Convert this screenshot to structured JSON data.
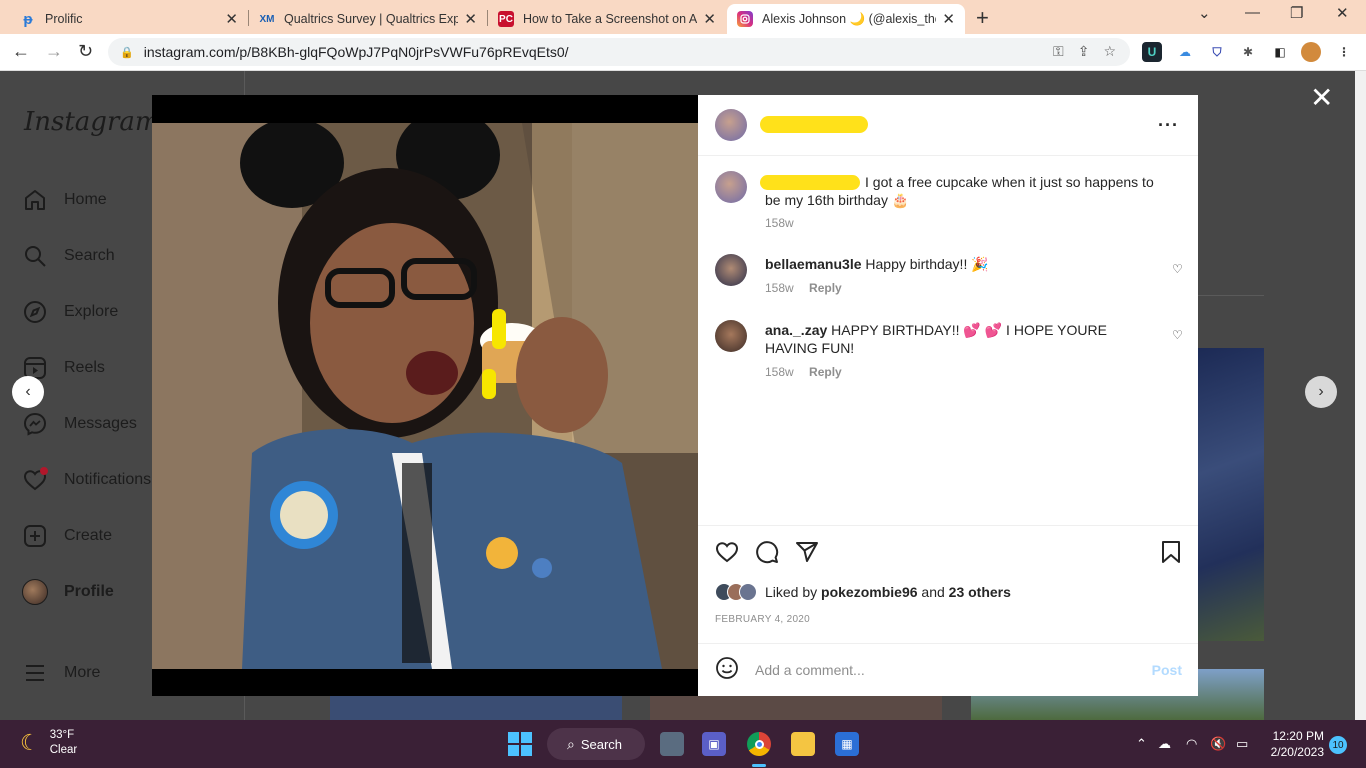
{
  "browser": {
    "tabs": [
      {
        "title": "Prolific",
        "favicon": "prolific-icon",
        "active": false
      },
      {
        "title": "Qualtrics Survey | Qualtrics Exper",
        "favicon": "XM",
        "active": false
      },
      {
        "title": "How to Take a Screenshot on Any",
        "favicon": "PC",
        "active": false
      },
      {
        "title": "Alexis Johnson 🌙 (@alexis_the_c",
        "favicon": "instagram-icon",
        "active": true
      }
    ],
    "url": "instagram.com/p/B8KBh-glqFQoWpJ7PqN0jrPsVWFu76pREvqEts0/"
  },
  "sidebar": {
    "logo": "Instagram",
    "items": [
      {
        "label": "Home",
        "icon": "home-icon"
      },
      {
        "label": "Search",
        "icon": "search-icon"
      },
      {
        "label": "Explore",
        "icon": "compass-icon"
      },
      {
        "label": "Reels",
        "icon": "reels-icon"
      },
      {
        "label": "Messages",
        "icon": "messenger-icon"
      },
      {
        "label": "Notifications",
        "icon": "heart-icon"
      },
      {
        "label": "Create",
        "icon": "plus-square-icon"
      },
      {
        "label": "Profile",
        "icon": "avatar"
      },
      {
        "label": "More",
        "icon": "menu-icon"
      }
    ]
  },
  "post": {
    "caption": "I got a free cupcake when it just so happens to be my 16th birthday 🎂",
    "caption_age": "158w",
    "comments": [
      {
        "user": "bellaemanu3le",
        "text": "Happy birthday!! 🎉",
        "age": "158w",
        "reply": "Reply"
      },
      {
        "user": "ana._.zay",
        "text": "HAPPY BIRTHDAY!! 💕 💕  I HOPE YOURE HAVING FUN!",
        "age": "158w",
        "reply": "Reply"
      }
    ],
    "liked_prefix": "Liked by",
    "liked_user": "pokezombie96",
    "liked_and": "and",
    "liked_others": "23 others",
    "date": "FEBRUARY 4, 2020",
    "comment_placeholder": "Add a comment...",
    "post_label": "Post"
  },
  "taskbar": {
    "temp": "33°F",
    "condition": "Clear",
    "search_label": "Search",
    "time": "12:20 PM",
    "date": "2/20/2023",
    "notification_count": "10"
  }
}
